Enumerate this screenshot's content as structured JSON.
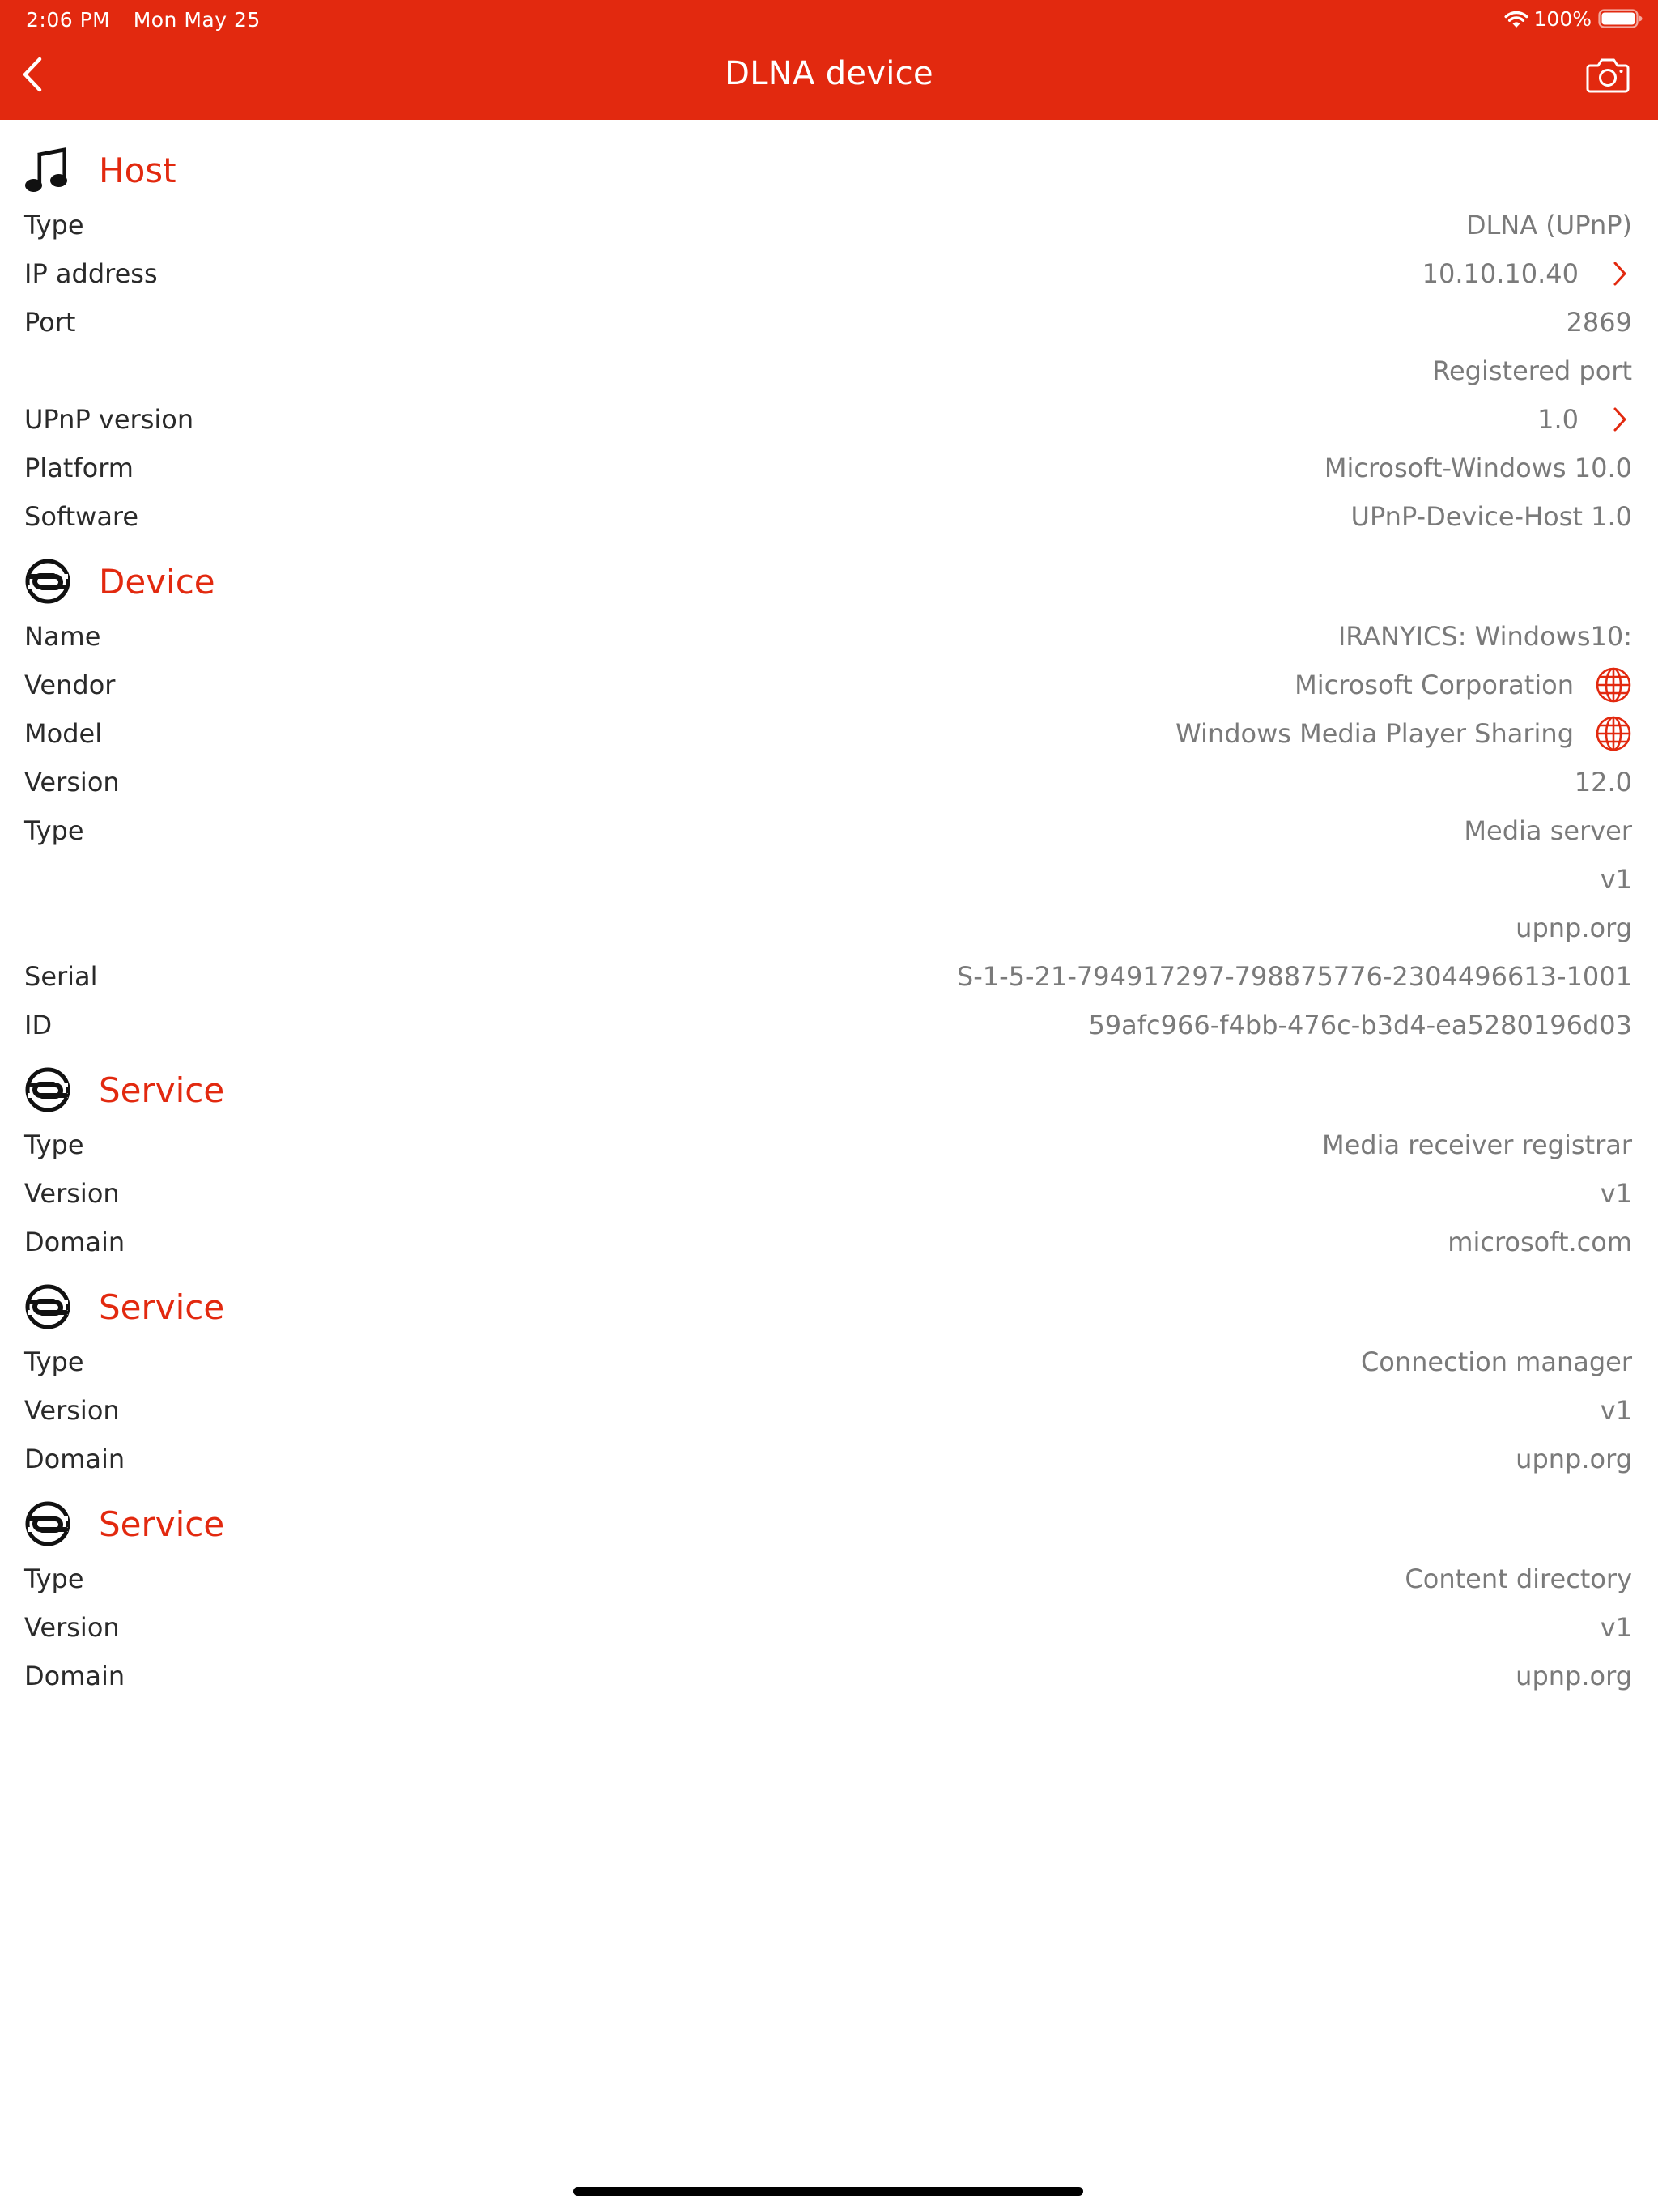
{
  "status_bar": {
    "time": "2:06 PM",
    "date": "Mon May 25",
    "battery": "100%"
  },
  "nav": {
    "title": "DLNA device"
  },
  "colors": {
    "accent": "#e2290f",
    "label": "#2a2a2a",
    "value": "#7a7a7a"
  },
  "sections": [
    {
      "title": "Host",
      "icon": "music-note-icon",
      "rows": [
        {
          "label": "Type",
          "value": "DLNA (UPnP)"
        },
        {
          "label": "IP address",
          "value": "10.10.10.40",
          "accessory": "chevron-right-icon"
        },
        {
          "label": "Port",
          "value": "2869"
        },
        {
          "label": "",
          "value": "Registered port"
        },
        {
          "label": "UPnP version",
          "value": "1.0",
          "accessory": "chevron-right-icon"
        },
        {
          "label": "Platform",
          "value": "Microsoft-Windows 10.0"
        },
        {
          "label": "Software",
          "value": "UPnP-Device-Host 1.0"
        }
      ]
    },
    {
      "title": "Device",
      "icon": "upnp-link-icon",
      "rows": [
        {
          "label": "Name",
          "value": "IRANYICS: Windows10:"
        },
        {
          "label": "Vendor",
          "value": "Microsoft Corporation",
          "accessory": "globe-icon"
        },
        {
          "label": "Model",
          "value": "Windows Media Player Sharing",
          "accessory": "globe-icon"
        },
        {
          "label": "Version",
          "value": "12.0"
        },
        {
          "label": "Type",
          "value": "Media server"
        },
        {
          "label": "",
          "value": "v1"
        },
        {
          "label": "",
          "value": "upnp.org"
        },
        {
          "label": "Serial",
          "value": "S-1-5-21-794917297-798875776-2304496613-1001"
        },
        {
          "label": "ID",
          "value": "59afc966-f4bb-476c-b3d4-ea5280196d03"
        }
      ]
    },
    {
      "title": "Service",
      "icon": "upnp-link-icon",
      "rows": [
        {
          "label": "Type",
          "value": "Media receiver registrar"
        },
        {
          "label": "Version",
          "value": "v1"
        },
        {
          "label": "Domain",
          "value": "microsoft.com"
        }
      ]
    },
    {
      "title": "Service",
      "icon": "upnp-link-icon",
      "rows": [
        {
          "label": "Type",
          "value": "Connection manager"
        },
        {
          "label": "Version",
          "value": "v1"
        },
        {
          "label": "Domain",
          "value": "upnp.org"
        }
      ]
    },
    {
      "title": "Service",
      "icon": "upnp-link-icon",
      "rows": [
        {
          "label": "Type",
          "value": "Content directory"
        },
        {
          "label": "Version",
          "value": "v1"
        },
        {
          "label": "Domain",
          "value": "upnp.org"
        }
      ]
    }
  ]
}
